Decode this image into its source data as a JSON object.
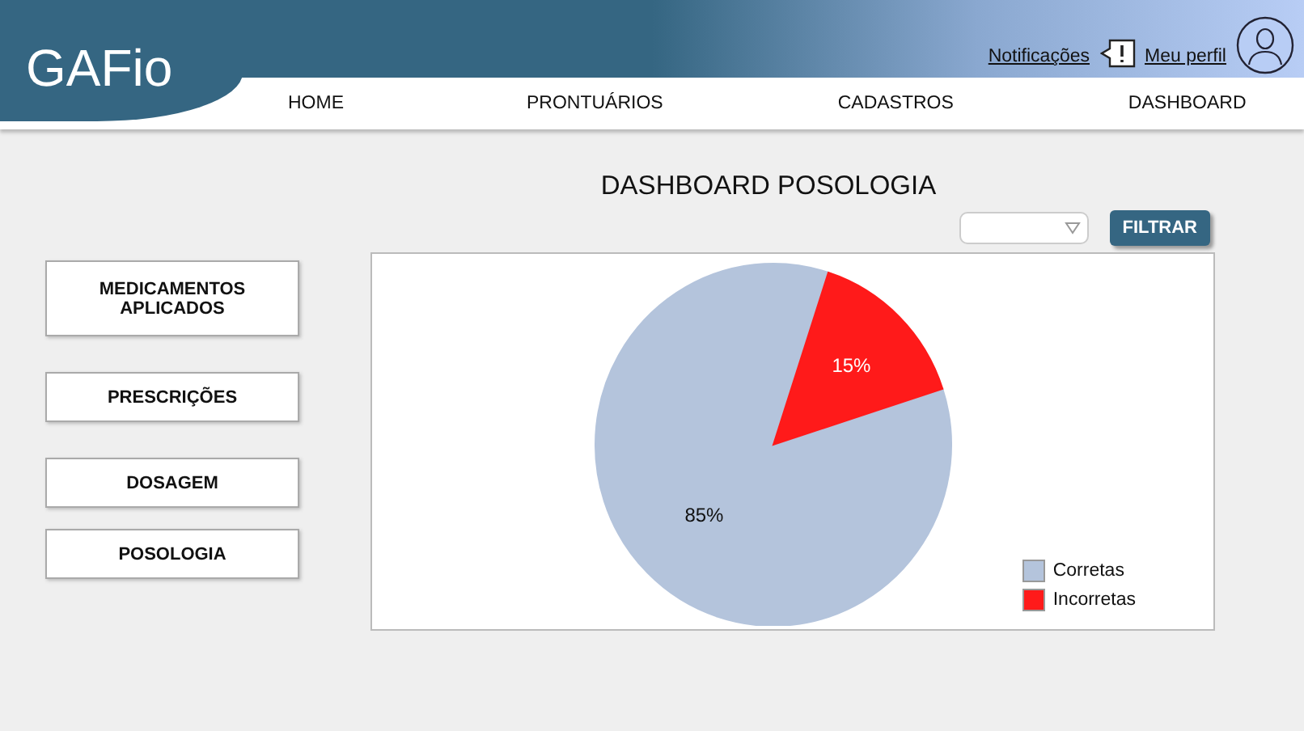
{
  "header": {
    "logo": "GAFio",
    "notifications": "Notificações",
    "profile": "Meu perfil"
  },
  "nav": [
    {
      "label": "HOME",
      "selected": false
    },
    {
      "label": "PRONTUÁRIOS",
      "selected": false
    },
    {
      "label": "CADASTROS",
      "selected": false
    },
    {
      "label": "DASHBOARD",
      "selected": false
    }
  ],
  "sidebar": [
    {
      "label": "MEDICAMENTOS APLICADOS"
    },
    {
      "label": "PRESCRIÇÕES"
    },
    {
      "label": "DOSAGEM"
    },
    {
      "label": "POSOLOGIA"
    }
  ],
  "page_title": "DASHBOARD POSOLOGIA",
  "filter_button": "FILTRAR",
  "chart_data": {
    "type": "pie",
    "categories": [
      "Corretas",
      "Incorretas"
    ],
    "series": [
      {
        "values": [
          85,
          15
        ]
      }
    ],
    "colors": [
      "#b4c4dc",
      "#ff1a1a"
    ],
    "value_labels": [
      "85%",
      "15%"
    ],
    "legend": true
  }
}
